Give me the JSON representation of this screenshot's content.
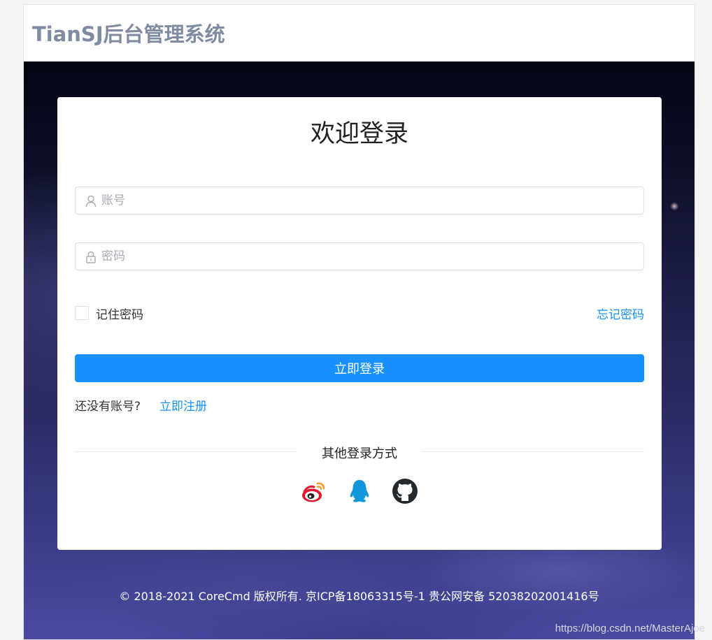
{
  "header": {
    "title": "TianSJ后台管理系统"
  },
  "card": {
    "welcome": "欢迎登录",
    "username": {
      "placeholder": "账号",
      "value": ""
    },
    "password": {
      "placeholder": "密码",
      "value": ""
    },
    "remember_label": "记住密码",
    "forgot_label": "忘记密码",
    "login_label": "立即登录",
    "no_account_label": "还没有账号?",
    "register_label": "立即注册",
    "other_methods_label": "其他登录方式",
    "social": [
      {
        "name": "weibo-icon",
        "color": "#e6162d"
      },
      {
        "name": "qq-icon",
        "color": "#1296db"
      },
      {
        "name": "github-icon",
        "color": "#24292e"
      }
    ]
  },
  "footer": {
    "copyright": "© 2018-2021 CoreCmd 版权所有. 京ICP备18063315号-1 贵公网安备 52038202001416号"
  },
  "watermark": "https://blog.csdn.net/MasterAjoe",
  "colors": {
    "primary": "#1890ff",
    "title": "#7e8ba1"
  }
}
